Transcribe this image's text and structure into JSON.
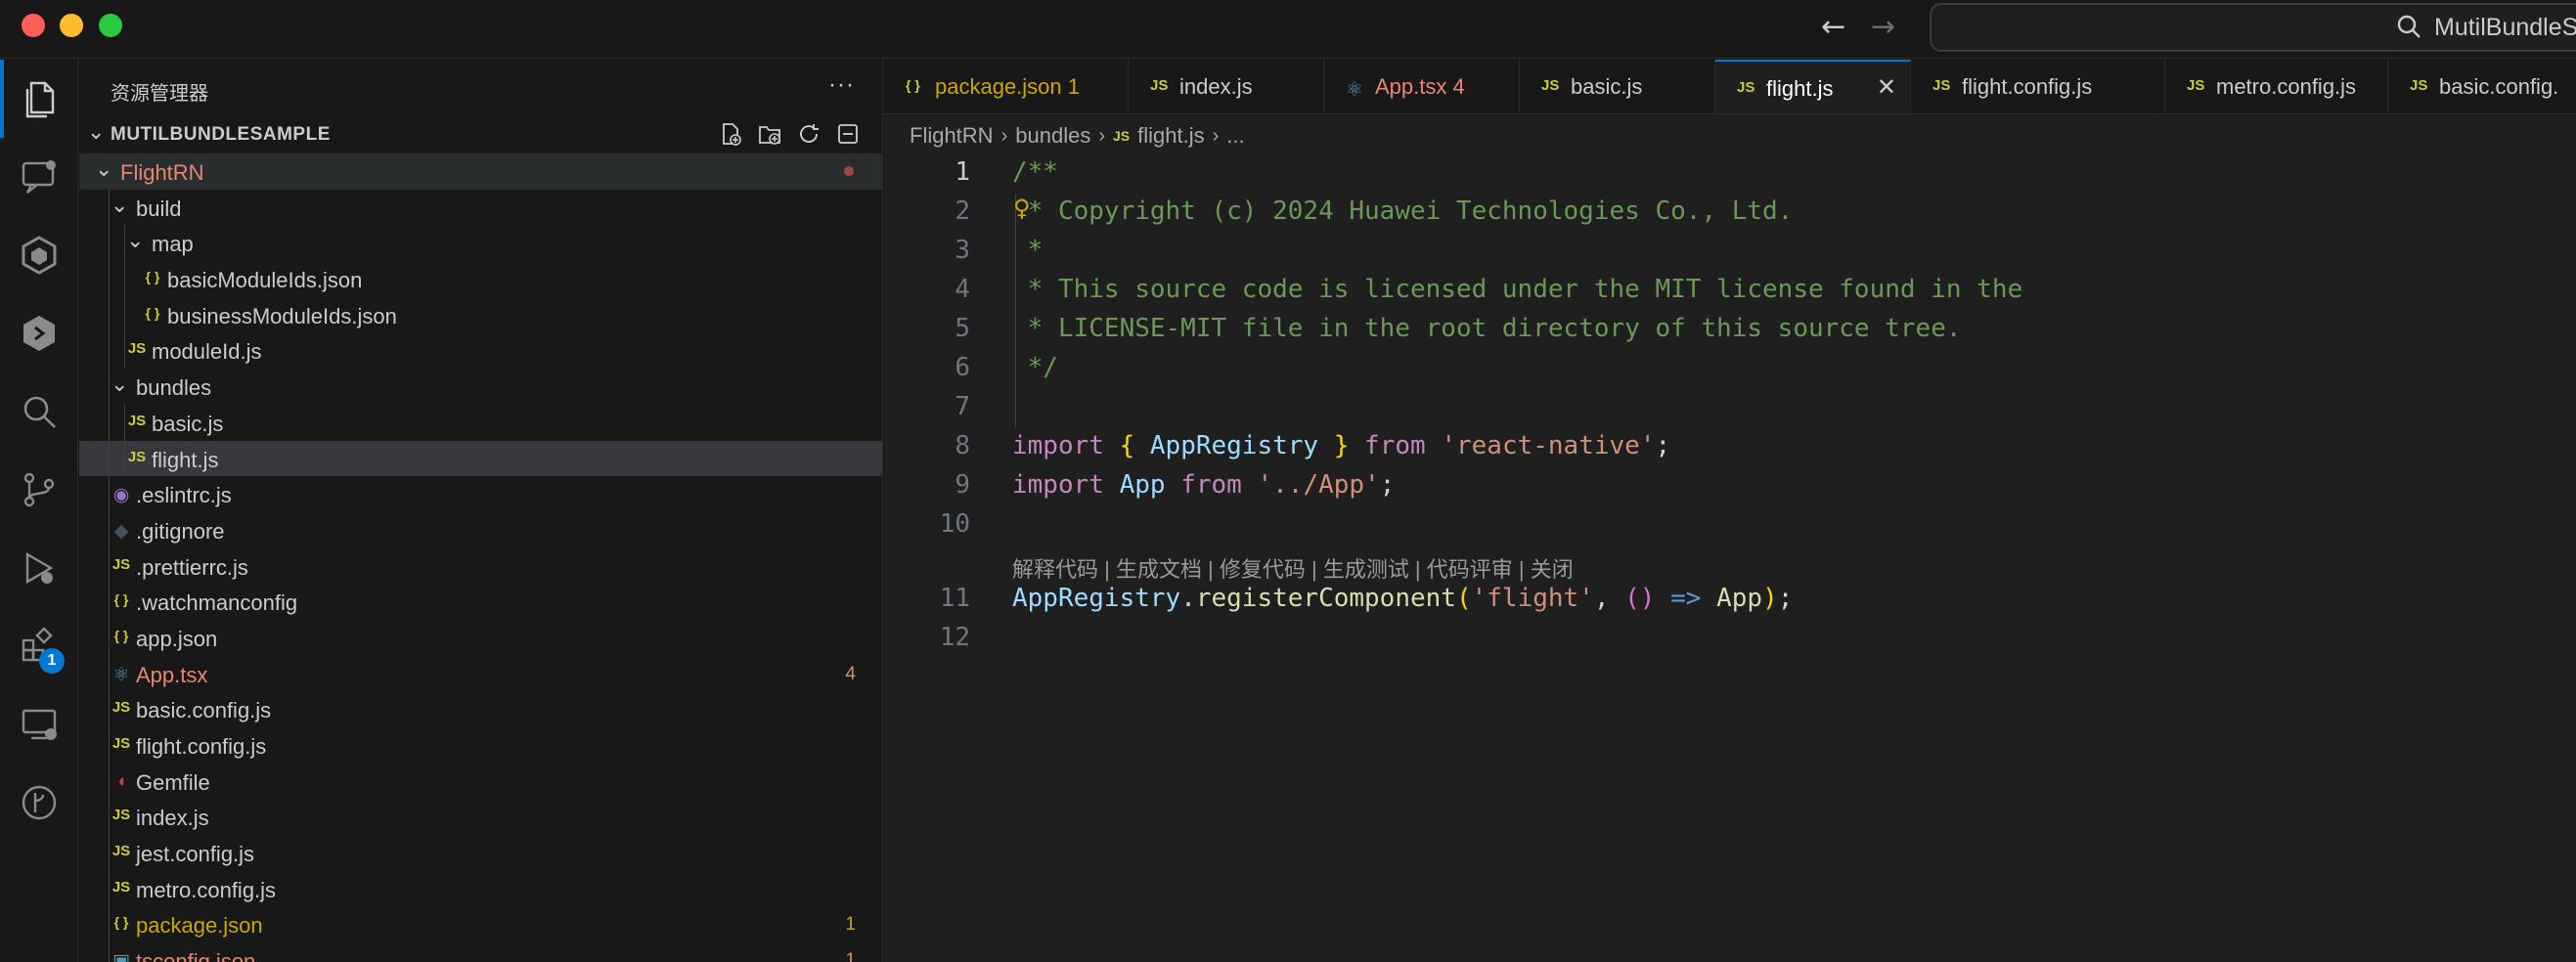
{
  "window": {
    "search_label": "MutilBundleS"
  },
  "activity": {
    "extensions_badge": "1"
  },
  "sidebar": {
    "header": "资源管理器",
    "more": "···",
    "section_title": "MUTILBUNDLESAMPLE",
    "tree": [
      {
        "label": "FlightRN",
        "kind": "folder",
        "depth": 0,
        "open": true,
        "color": "#e8866f",
        "dot": true,
        "root": true
      },
      {
        "label": "build",
        "kind": "folder",
        "depth": 1,
        "open": true
      },
      {
        "label": "map",
        "kind": "folder",
        "depth": 2,
        "open": true
      },
      {
        "label": "basicModuleIds.json",
        "kind": "json",
        "depth": 3
      },
      {
        "label": "businessModuleIds.json",
        "kind": "json",
        "depth": 3
      },
      {
        "label": "moduleId.js",
        "kind": "js",
        "depth": 2
      },
      {
        "label": "bundles",
        "kind": "folder",
        "depth": 1,
        "open": true
      },
      {
        "label": "basic.js",
        "kind": "js",
        "depth": 2
      },
      {
        "label": "flight.js",
        "kind": "js",
        "depth": 2,
        "selected": true
      },
      {
        "label": ".eslintrc.js",
        "kind": "eslint",
        "depth": 1
      },
      {
        "label": ".gitignore",
        "kind": "git",
        "depth": 1
      },
      {
        "label": ".prettierrc.js",
        "kind": "js",
        "depth": 1
      },
      {
        "label": ".watchmanconfig",
        "kind": "json",
        "depth": 1
      },
      {
        "label": "app.json",
        "kind": "json",
        "depth": 1
      },
      {
        "label": "App.tsx",
        "kind": "react",
        "depth": 1,
        "color": "#e8866f",
        "badge": "4"
      },
      {
        "label": "basic.config.js",
        "kind": "js",
        "depth": 1
      },
      {
        "label": "flight.config.js",
        "kind": "js",
        "depth": 1
      },
      {
        "label": "Gemfile",
        "kind": "gem",
        "depth": 1
      },
      {
        "label": "index.js",
        "kind": "js",
        "depth": 1
      },
      {
        "label": "jest.config.js",
        "kind": "js",
        "depth": 1
      },
      {
        "label": "metro.config.js",
        "kind": "js",
        "depth": 1
      },
      {
        "label": "package.json",
        "kind": "json",
        "depth": 1,
        "color": "#cca700",
        "badge": "1"
      },
      {
        "label": "tsconfig.json",
        "kind": "ts",
        "depth": 1,
        "color": "#e8866f",
        "badge": "1"
      }
    ]
  },
  "tabs": [
    {
      "label": "package.json 1",
      "kind": "json",
      "color": "#cca700"
    },
    {
      "label": "index.js",
      "kind": "js"
    },
    {
      "label": "App.tsx 4",
      "kind": "react",
      "color": "#e8866f"
    },
    {
      "label": "basic.js",
      "kind": "js"
    },
    {
      "label": "flight.js",
      "kind": "js",
      "active": true
    },
    {
      "label": "flight.config.js",
      "kind": "js"
    },
    {
      "label": "metro.config.js",
      "kind": "js"
    },
    {
      "label": "basic.config.",
      "kind": "js"
    }
  ],
  "breadcrumb": [
    "FlightRN",
    "bundles",
    "flight.js",
    "..."
  ],
  "code": {
    "codelens": "解释代码 | 生成文档 | 修复代码 | 生成测试 | 代码评审 | 关闭",
    "current_line": 1,
    "lines": [
      {
        "n": "1",
        "tokens": [
          [
            "/**",
            "com"
          ]
        ]
      },
      {
        "n": "2",
        "tokens": [
          [
            " * Copyright (c) 2024 Huawei Technologies Co., Ltd.",
            "com"
          ]
        ]
      },
      {
        "n": "3",
        "tokens": [
          [
            " *",
            "com"
          ]
        ]
      },
      {
        "n": "4",
        "tokens": [
          [
            " * This source code is licensed under the MIT license found in the",
            "com"
          ]
        ]
      },
      {
        "n": "5",
        "tokens": [
          [
            " * LICENSE-MIT file in the root directory of this source tree.",
            "com"
          ]
        ]
      },
      {
        "n": "6",
        "tokens": [
          [
            " */",
            "com"
          ]
        ]
      },
      {
        "n": "7",
        "tokens": []
      },
      {
        "n": "8",
        "tokens": [
          [
            "import",
            "kw"
          ],
          [
            " ",
            "plain"
          ],
          [
            "{",
            "br"
          ],
          [
            " AppRegistry ",
            "id"
          ],
          [
            "}",
            "br"
          ],
          [
            " ",
            "plain"
          ],
          [
            "from",
            "kw"
          ],
          [
            " ",
            "plain"
          ],
          [
            "'react-native'",
            "str"
          ],
          [
            ";",
            "plain"
          ]
        ]
      },
      {
        "n": "9",
        "tokens": [
          [
            "import",
            "kw"
          ],
          [
            " App ",
            "id"
          ],
          [
            "from",
            "kw"
          ],
          [
            " ",
            "plain"
          ],
          [
            "'../App'",
            "str"
          ],
          [
            ";",
            "plain"
          ]
        ]
      },
      {
        "n": "10",
        "tokens": []
      },
      {
        "n": "11",
        "tokens": [
          [
            "AppRegistry",
            "id"
          ],
          [
            ".",
            "plain"
          ],
          [
            "registerComponent",
            "fn"
          ],
          [
            "(",
            "br"
          ],
          [
            "'flight'",
            "str"
          ],
          [
            ", ",
            "plain"
          ],
          [
            "()",
            "br2"
          ],
          [
            " ",
            "plain"
          ],
          [
            "=>",
            "arrow"
          ],
          [
            " App",
            "id"
          ],
          [
            ")",
            "br"
          ],
          [
            ";",
            "plain"
          ]
        ]
      },
      {
        "n": "12",
        "tokens": []
      }
    ]
  }
}
